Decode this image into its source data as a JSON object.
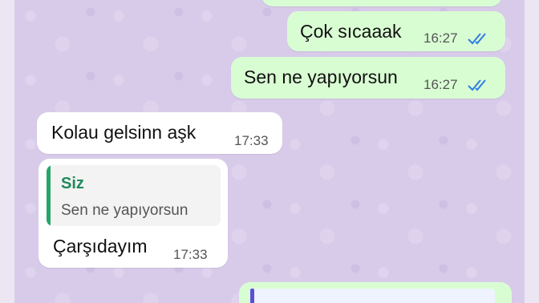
{
  "messages": [
    {
      "text": "Çok sıcaaak",
      "time": "16:27",
      "direction": "outgoing",
      "status": "read"
    },
    {
      "text": "Sen ne yapıyorsun",
      "time": "16:27",
      "direction": "outgoing",
      "status": "read"
    },
    {
      "text": "Kolau gelsinn aşk",
      "time": "17:33",
      "direction": "incoming"
    },
    {
      "text": "Çarşıdayım",
      "time": "17:33",
      "direction": "incoming",
      "reply_to": {
        "author": "Siz",
        "text": "Sen ne yapıyorsun"
      }
    }
  ],
  "colors": {
    "outgoing_bubble": "#d9fdd3",
    "incoming_bubble": "#ffffff",
    "read_ticks": "#53bdeb",
    "quote_accent": "#25a56a",
    "wallpaper": "#d8cbea"
  },
  "icons": {
    "read_receipt": "double-check-icon"
  }
}
